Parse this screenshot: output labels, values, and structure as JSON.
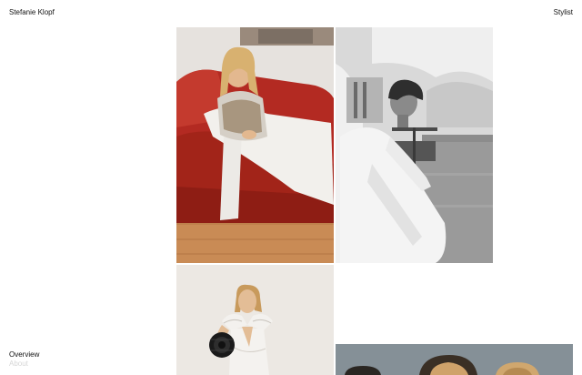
{
  "header": {
    "site_name": "Stefanie Klopf",
    "section": "Stylist"
  },
  "nav": {
    "overview": "Overview",
    "about": "About"
  },
  "gallery": {
    "photos": [
      {
        "subject": "woman on red leather sofa"
      },
      {
        "subject": "man in white coat on ship deck"
      },
      {
        "subject": "woman in white dress holding black disc"
      },
      {
        "subject": "group of people heads"
      }
    ]
  },
  "colors": {
    "text": "#111111",
    "muted_text": "#d6d6d6",
    "sofa_red": "#b32a22",
    "background": "#ffffff"
  }
}
